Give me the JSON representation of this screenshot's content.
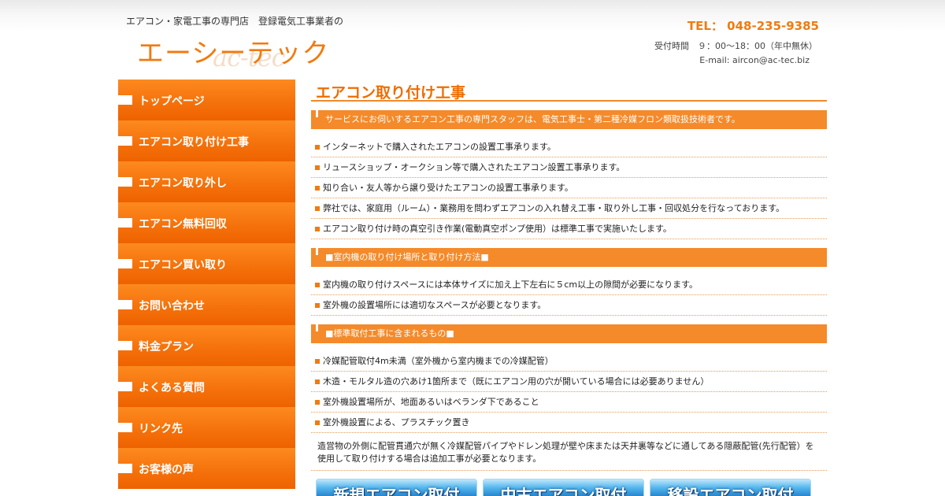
{
  "header": {
    "tagline": "エアコン・家電工事の専門店　登録電気工事業者の",
    "logo_text": "エーシーテック",
    "logo_sub": "ac-tec",
    "tel": "TEL：  048-235-9385",
    "hours": "受付時間　９：00～18：00（年中無休）",
    "email": "E-mail: aircon@ac-tec.biz"
  },
  "sidebar": {
    "items": [
      {
        "label": "トップページ"
      },
      {
        "label": "エアコン取り付け工事"
      },
      {
        "label": "エアコン取り外し"
      },
      {
        "label": "エアコン無料回収"
      },
      {
        "label": "エアコン買い取り"
      },
      {
        "label": "お問い合わせ"
      },
      {
        "label": "料金プラン"
      },
      {
        "label": "よくある質問"
      },
      {
        "label": "リンク先"
      },
      {
        "label": "お客様の声"
      }
    ]
  },
  "main": {
    "title": "エアコン取り付け工事",
    "intro_bar": "サービスにお伺いするエアコン工事の専門スタッフは、電気工事士・第二種冷媒フロン類取扱技術者です。",
    "list1": [
      "インターネットで購入されたエアコンの設置工事承ります。",
      "リュースショップ・オークション等で購入されたエアコン設置工事承ります。",
      "知り合い・友人等から譲り受けたエアコンの設置工事承ります。",
      "弊社では、家庭用（ルーム）・業務用を問わずエアコンの入れ替え工事・取り外し工事・回収処分を行なっております。",
      "エアコン取り付け時の真空引き作業(電動真空ポンプ使用）は標準工事で実施いたします。"
    ],
    "section2_bar": "■室内機の取り付け場所と取り付け方法■",
    "list2": [
      "室内機の取り付けスペースには本体サイズに加え上下左右に５cm以上の隙間が必要になります。",
      "室外機の設置場所には適切なスペースが必要となります。"
    ],
    "section3_bar": "■標準取付工事に含まれるもの■",
    "list3": [
      "冷媒配管取付4m未満（室外機から室内機までの冷媒配管）",
      "木造・モルタル造の穴あけ1箇所まで（既にエアコン用の穴が開いている場合には必要ありません）",
      "室外機設置場所が、地面あるいはベランダ下であること",
      "室外機設置による、プラスチック置き"
    ],
    "note_line1": "造営物の外側に配管貫通穴が無く冷媒配管パイプやドレン処理が壁や床または天井裏等などに通してある隠蔽配管(先行配管）を",
    "note_line2": "使用して取り付けする場合は追加工事が必要となります。",
    "buttons": [
      {
        "label": "新規エアコン取付"
      },
      {
        "label": "中古エアコン取付"
      },
      {
        "label": "移設エアコン取付"
      }
    ]
  },
  "colors": {
    "accent": "#f07b10",
    "nav_bg": "#f4700a",
    "button_blue": "#1b78c6"
  }
}
